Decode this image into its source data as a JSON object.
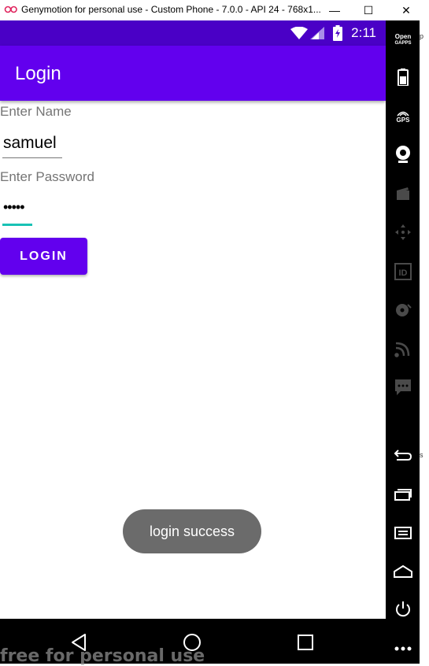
{
  "window": {
    "title": "Genymotion for personal use - Custom Phone - 7.0.0 - API 24 - 768x1...",
    "minimize": "—",
    "maximize": "☐",
    "close": "✕"
  },
  "status_bar": {
    "time": "2:11"
  },
  "app_bar": {
    "title": "Login"
  },
  "form": {
    "name_label": "Enter Name",
    "name_value": "samuel",
    "password_label": "Enter Password",
    "password_value": "•••••",
    "login_button": "LOGIN"
  },
  "toast": {
    "message": "login success"
  },
  "sidebar": {
    "opengapps_top": "Open",
    "opengapps_bottom": "GAPPS",
    "gps_label": "GPS",
    "id_label": "ID"
  },
  "watermark": "free for personal use",
  "edge_fragments": [
    "p",
    "s"
  ],
  "colors": {
    "status_bar": "#4a00c6",
    "app_bar": "#6200ee",
    "accent": "#19c2b5",
    "toast": "#6b6b6b"
  }
}
